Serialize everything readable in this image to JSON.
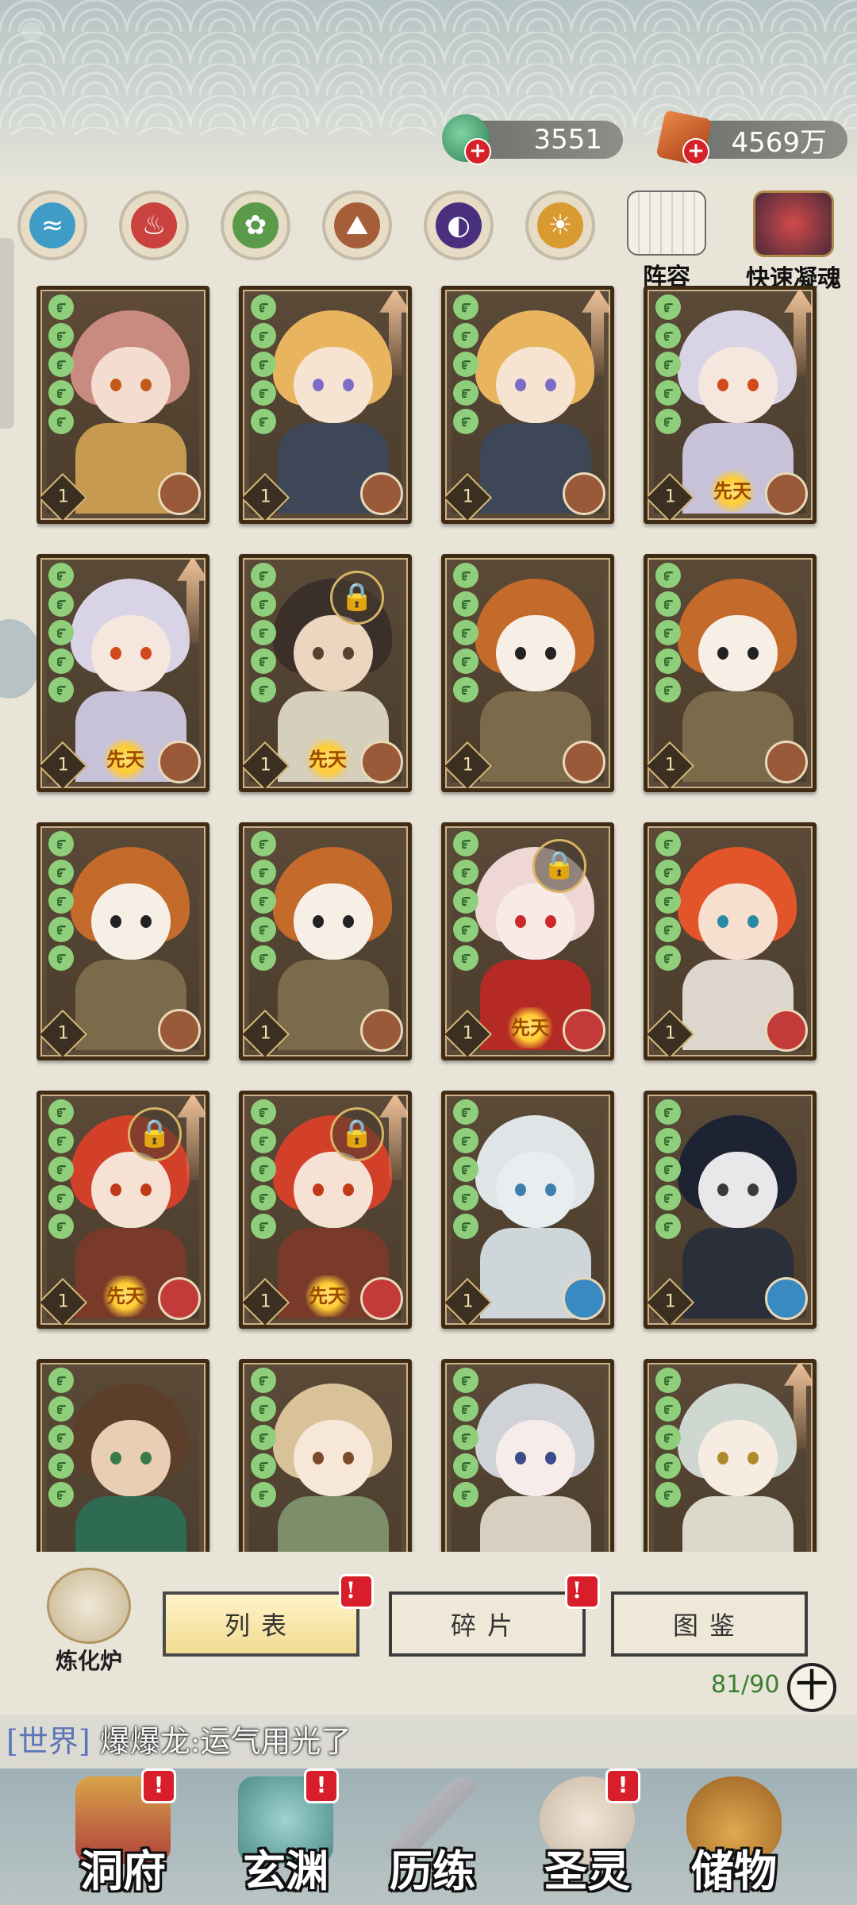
{
  "currencies": [
    {
      "name": "jade",
      "value": "3551",
      "color": "#3f9a6a"
    },
    {
      "name": "stone",
      "value": "4569万",
      "color": "#c4501e"
    }
  ],
  "element_filters": [
    {
      "icon": "water-icon",
      "color": "#3f9cc7",
      "glyph": "≈"
    },
    {
      "icon": "fire-icon",
      "color": "#c9423e",
      "glyph": "♨"
    },
    {
      "icon": "wood-icon",
      "color": "#5a9a4a",
      "glyph": "✿"
    },
    {
      "icon": "earth-icon",
      "color": "#a65e38",
      "glyph": "⛰"
    },
    {
      "icon": "dark-icon",
      "color": "#4b2f7f",
      "glyph": "◐"
    },
    {
      "icon": "light-icon",
      "color": "#d99a32",
      "glyph": "☀"
    }
  ],
  "top_buttons": {
    "lineup": "阵容",
    "quick_soul": "快速凝魂"
  },
  "cards": [
    {
      "hair": "#c98a80",
      "skin": "#f4ddd0",
      "eye": "#c45a1a",
      "body": "#c79a52",
      "bg": "#5e4a36",
      "level": "1",
      "element": "earth",
      "lock": false,
      "arrow": false,
      "innate": false
    },
    {
      "hair": "#e9b45e",
      "skin": "#f6e3d2",
      "eye": "#7c6cc7",
      "body": "#3d4758",
      "bg": "#5a4937",
      "level": "1",
      "element": "earth",
      "lock": false,
      "arrow": true,
      "innate": false
    },
    {
      "hair": "#e9b45e",
      "skin": "#f6e3d2",
      "eye": "#7c6cc7",
      "body": "#3d4758",
      "bg": "#5a4937",
      "level": "1",
      "element": "earth",
      "lock": false,
      "arrow": true,
      "innate": false
    },
    {
      "hair": "#d8d4e6",
      "skin": "#f6e7de",
      "eye": "#d24a1c",
      "body": "#c8c2d8",
      "bg": "#5a4937",
      "level": "1",
      "element": "earth",
      "lock": false,
      "arrow": true,
      "innate": true
    },
    {
      "hair": "#d8d4e6",
      "skin": "#f6e7de",
      "eye": "#d24a1c",
      "body": "#c8c2d8",
      "bg": "#5a4937",
      "level": "1",
      "element": "earth",
      "lock": false,
      "arrow": true,
      "innate": true
    },
    {
      "hair": "#3b2f2a",
      "skin": "#ecd6c0",
      "eye": "#5a4030",
      "body": "#d6cfbc",
      "bg": "#5a4937",
      "level": "1",
      "element": "earth",
      "lock": true,
      "arrow": false,
      "innate": true
    },
    {
      "hair": "#c46a2a",
      "skin": "#f7efe6",
      "eye": "#222222",
      "body": "#7b6b4a",
      "bg": "#5a4937",
      "level": "1",
      "element": "earth",
      "lock": false,
      "arrow": false,
      "innate": false
    },
    {
      "hair": "#c46a2a",
      "skin": "#f7efe6",
      "eye": "#222222",
      "body": "#7b6b4a",
      "bg": "#5a4937",
      "level": "1",
      "element": "earth",
      "lock": false,
      "arrow": false,
      "innate": false
    },
    {
      "hair": "#c46a2a",
      "skin": "#f7efe6",
      "eye": "#222222",
      "body": "#7b6b4a",
      "bg": "#5a4937",
      "level": "1",
      "element": "earth",
      "lock": false,
      "arrow": false,
      "innate": false
    },
    {
      "hair": "#c46a2a",
      "skin": "#f7efe6",
      "eye": "#222222",
      "body": "#7b6b4a",
      "bg": "#5a4937",
      "level": "1",
      "element": "earth",
      "lock": false,
      "arrow": false,
      "innate": false
    },
    {
      "hair": "#eed7d4",
      "skin": "#f8ebe6",
      "eye": "#cc2a2a",
      "body": "#b52a24",
      "bg": "#5a4937",
      "level": "1",
      "element": "fire",
      "lock": true,
      "arrow": false,
      "innate": true
    },
    {
      "hair": "#e2552a",
      "skin": "#f6dfcf",
      "eye": "#2a8aa6",
      "body": "#dcd6cc",
      "bg": "#5a4937",
      "level": "1",
      "element": "fire",
      "lock": false,
      "arrow": false,
      "innate": false
    },
    {
      "hair": "#d2402a",
      "skin": "#f6e2d4",
      "eye": "#c23a1a",
      "body": "#7a3a2a",
      "bg": "#5a4937",
      "level": "1",
      "element": "fire",
      "lock": true,
      "arrow": true,
      "innate": true
    },
    {
      "hair": "#d2402a",
      "skin": "#f6e2d4",
      "eye": "#c23a1a",
      "body": "#7a3a2a",
      "bg": "#5a4937",
      "level": "1",
      "element": "fire",
      "lock": true,
      "arrow": true,
      "innate": true
    },
    {
      "hair": "#dfe4e6",
      "skin": "#e8eef0",
      "eye": "#3f7fb0",
      "body": "#cfd6da",
      "bg": "#5a4937",
      "level": "1",
      "element": "water",
      "lock": false,
      "arrow": false,
      "innate": false
    },
    {
      "hair": "#1e2333",
      "skin": "#e8e8ea",
      "eye": "#3a3a3a",
      "body": "#2a2f3a",
      "bg": "#5a4937",
      "level": "1",
      "element": "water",
      "lock": false,
      "arrow": false,
      "innate": false
    },
    {
      "hair": "#5b3f2a",
      "skin": "#e8cfb4",
      "eye": "#3a7a4a",
      "body": "#2f6a52",
      "bg": "#5a4937",
      "level": "",
      "element": "",
      "lock": false,
      "arrow": false,
      "innate": false
    },
    {
      "hair": "#d9c29a",
      "skin": "#f6e7d8",
      "eye": "#7a4a2a",
      "body": "#7c8e6a",
      "bg": "#5a4937",
      "level": "",
      "element": "",
      "lock": false,
      "arrow": false,
      "innate": false
    },
    {
      "hair": "#cfd2d6",
      "skin": "#f6ecea",
      "eye": "#3a4a8a",
      "body": "#d8cfc0",
      "bg": "#5a4937",
      "level": "",
      "element": "",
      "lock": false,
      "arrow": false,
      "innate": false
    },
    {
      "hair": "#cfd8d0",
      "skin": "#f6ece2",
      "eye": "#b08a2a",
      "body": "#dcd8cc",
      "bg": "#5a4937",
      "level": "",
      "element": "",
      "lock": false,
      "arrow": true,
      "innate": false
    }
  ],
  "innate_label": "先天",
  "element_colors": {
    "earth": "#9a5a3a",
    "fire": "#c23a3a",
    "water": "#3a8ac2"
  },
  "bottom": {
    "furnace_label": "炼化炉",
    "tabs": [
      {
        "label": "列表",
        "active": true,
        "badge": "!"
      },
      {
        "label": "碎片",
        "active": false,
        "badge": "!"
      },
      {
        "label": "图鉴",
        "active": false,
        "badge": ""
      }
    ],
    "count": "81/90",
    "add_symbol": "十"
  },
  "chat": {
    "channel": "[世界]",
    "message": "爆爆龙:运气用光了"
  },
  "nav": [
    {
      "label": "洞府",
      "icon": "cave-house-icon",
      "badge": "!",
      "color": "#b0413a"
    },
    {
      "label": "玄渊",
      "icon": "abyss-icon",
      "badge": "!",
      "color": "#4f8c8a"
    },
    {
      "label": "历练",
      "icon": "sword-icon",
      "badge": "",
      "color": "#8a8a92"
    },
    {
      "label": "圣灵",
      "icon": "tiger-spirit-icon",
      "badge": "!",
      "color": "#c9b9a4"
    },
    {
      "label": "储物",
      "icon": "bag-icon",
      "badge": "",
      "color": "#c08a3a"
    }
  ]
}
